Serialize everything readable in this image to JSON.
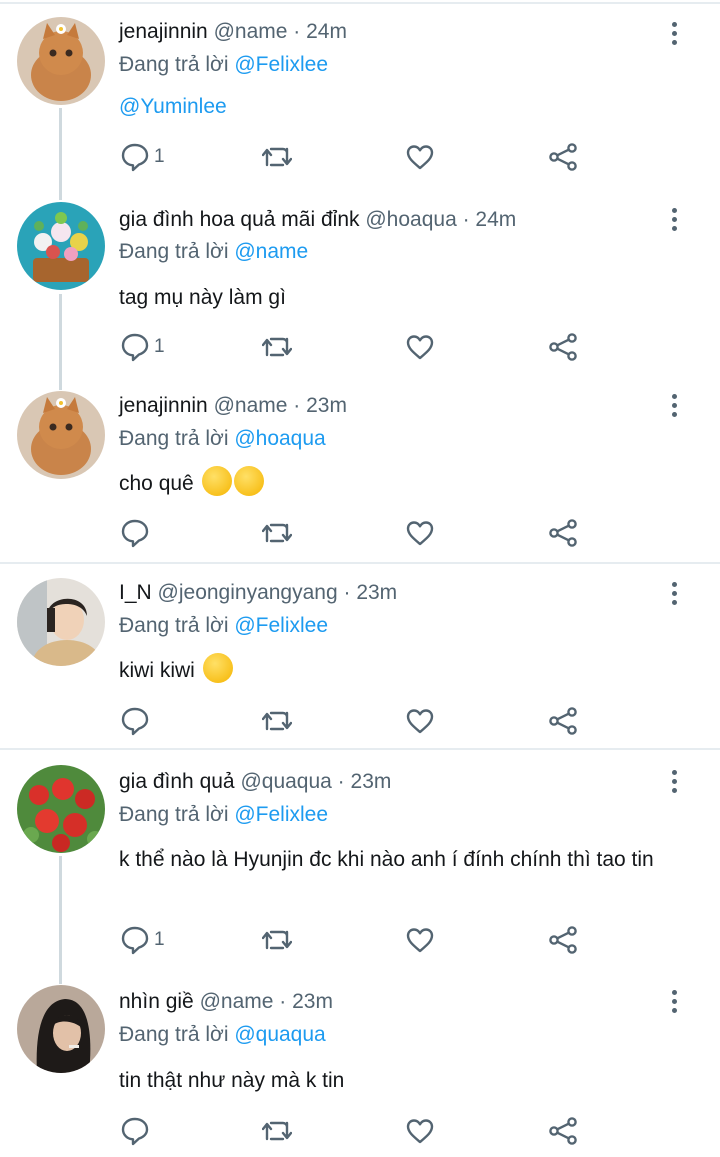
{
  "reply_prefix": "Đang trả lời",
  "posts": [
    {
      "display_name": "jenajinnin",
      "meta": "@name · 24m",
      "reply_to": "@Felixlee",
      "text": "",
      "text_mention": "@Yuminlee",
      "reply_count": "1",
      "avatar": "cat"
    },
    {
      "display_name": "gia đình hoa quả mãi đỉnk",
      "meta": "@hoaqua · 24m",
      "reply_to": "@name",
      "text": "tag mụ này làm gì",
      "reply_count": "1",
      "avatar": "flowers"
    },
    {
      "display_name": "jenajinnin",
      "meta": "@name · 23m",
      "reply_to": "@hoaqua",
      "text": "cho quê",
      "emoji": [
        "rolling-on-floor-laughing-emoji",
        "rolling-on-floor-laughing-emoji"
      ],
      "reply_count": "",
      "avatar": "cat"
    },
    {
      "display_name": "I_N",
      "meta": "@jeonginyangyang · 23m",
      "reply_to": "@Felixlee",
      "text": "kiwi kiwi",
      "emoji": [
        "drooling-face-emoji"
      ],
      "reply_count": "",
      "avatar": "boy"
    },
    {
      "display_name": "gia đình quả",
      "meta": "@quaqua · 23m",
      "reply_to": "@Felixlee",
      "text": "k thể nào là Hyunjin đc khi nào anh í đính chính thì tao tin",
      "reply_count": "1",
      "avatar": "strawberries"
    },
    {
      "display_name": "nhìn giề",
      "meta": "@name · 23m",
      "reply_to": "@quaqua",
      "text": "tin thật như này mà k tin",
      "reply_count": "",
      "avatar": "girl"
    }
  ],
  "icons": {
    "reply": "comment-icon",
    "retweet": "retweet-icon",
    "like": "heart-icon",
    "share": "share-icon",
    "more": "more-vertical-icon"
  },
  "colors": {
    "mention": "#1d9bf0",
    "secondary_text": "#536471",
    "thread_line": "#cfd9de",
    "divider": "#e6ecf0"
  }
}
